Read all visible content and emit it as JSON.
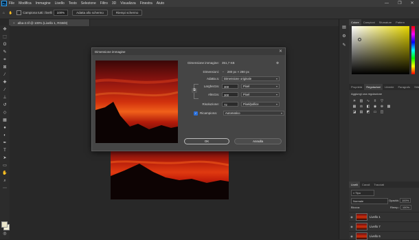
{
  "app": {
    "logo": "Ps"
  },
  "menubar": {
    "items": [
      "File",
      "Modifica",
      "Immagine",
      "Livello",
      "Testo",
      "Selezione",
      "Filtro",
      "3D",
      "Visualizza",
      "Finestra",
      "Aiuto"
    ],
    "controls": {
      "minimize": "—",
      "maximize": "❐",
      "close": "✕"
    }
  },
  "options_bar": {
    "campiona_label": "Campiona tutti i livelli",
    "zoom_value": "100%",
    "adatta_schermo": "Adatta allo schermo",
    "riempi_schermo": "Riempi schermo"
  },
  "document_tab": {
    "title": "alba-2.tif @ 100% (Livello 1, RGB/8)",
    "close": "×"
  },
  "dialog": {
    "title": "Dimensione immagine",
    "close": "✕",
    "dimensione_label": "Dimensione immagine:",
    "dimensione_value": "351,7 KB",
    "gear": "⚙",
    "dimensioni_label": "Dimensioni:",
    "dimensioni_value": "280 px × 280 px",
    "adatta_label": "Adatta a:",
    "adatta_value": "Dimensione originale",
    "larghezza_label": "Larghezza:",
    "larghezza_value": "300",
    "larghezza_unit": "Pixel",
    "altezza_label": "Altezza:",
    "altezza_value": "300",
    "altezza_unit": "Pixel",
    "risoluzione_label": "Risoluzione:",
    "risoluzione_value": "72",
    "risoluzione_unit": "Pixel/pollice",
    "ricampiona_label": "Ricampiona:",
    "ricampiona_checked": true,
    "ricampiona_value": "Automatico",
    "ok_label": "OK",
    "annulla_label": "Annulla"
  },
  "panels": {
    "color_tabs": [
      "Colore",
      "Campioni",
      "Sfumature",
      "Pattern"
    ],
    "adjust_tabs": [
      "Proprietà",
      "Regolazioni",
      "Librerie",
      "Paragrafo",
      "Stile"
    ],
    "adjust_title": "Aggiungi una regolazione",
    "layers_tabs": [
      "Livelli",
      "Canali",
      "Tracciati"
    ],
    "layers_search": "Tipo",
    "layers_mode": "Normale",
    "opacity_label": "Opacità:",
    "opacity_value": "100%",
    "fill_label": "Riemp.:",
    "fill_value": "100%",
    "blocca_label": "Blocca:",
    "layers": [
      "Livello 1",
      "Livello 7",
      "Livello 6"
    ]
  },
  "colors": {
    "accent": "#31a8ff",
    "ok_button": "#2b6fd8"
  }
}
